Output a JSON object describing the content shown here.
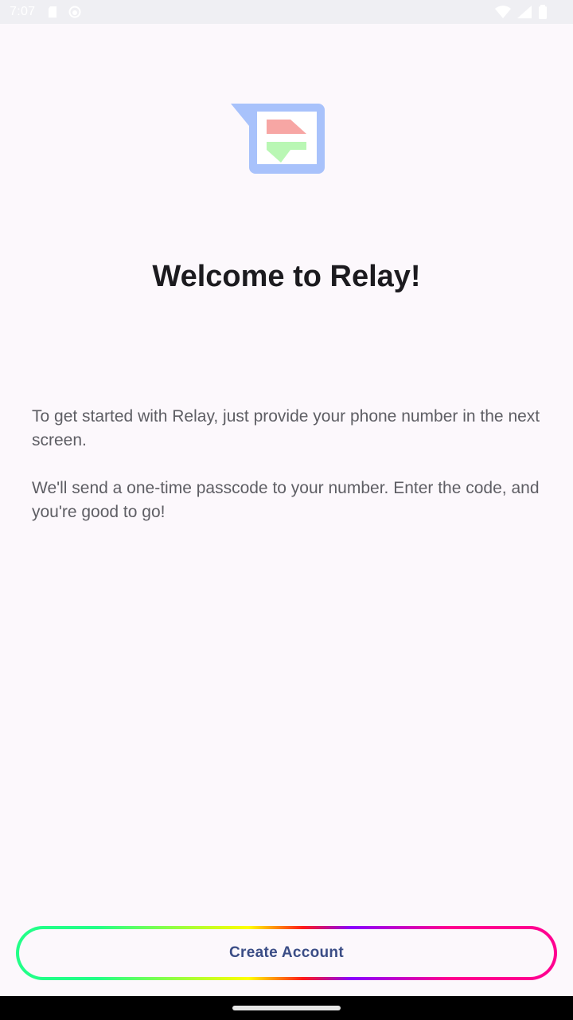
{
  "status_bar": {
    "time": "7:07",
    "left_icons": [
      "sd-card-icon",
      "circle-status-icon"
    ],
    "right_icons": [
      "wifi-icon",
      "signal-icon",
      "battery-icon"
    ]
  },
  "logo": {
    "icon": "relay-exchange-icon",
    "colors": {
      "frame": "#a8c2fb",
      "arrow_up": "#f7a6a4",
      "arrow_down": "#b9f7b4"
    }
  },
  "welcome": {
    "title": "Welcome to Relay!",
    "paragraph_1": "To get started with Relay, just provide your phone number in the next screen.",
    "paragraph_2": "We'll send a one-time passcode to your number. Enter the code, and you're good to go!"
  },
  "actions": {
    "create_account_label": "Create Account"
  },
  "colors": {
    "background": "#fcf8fc",
    "button_text": "#3b4d86",
    "body_text": "#5e5e64"
  }
}
